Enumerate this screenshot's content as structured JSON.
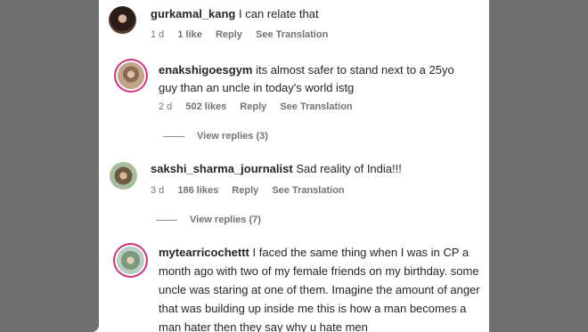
{
  "comments": [
    {
      "username": "gurkamal_kang",
      "text": "I can relate that",
      "time": "1 d",
      "likes": "1 like",
      "reply": "Reply",
      "translate": "See Translation"
    },
    {
      "username": "enakshigoesgym",
      "text": "its almost safer to stand next to a 25yo guy than an uncle in today's world istg",
      "time": "2 d",
      "likes": "502 likes",
      "reply": "Reply",
      "translate": "See Translation",
      "view_replies": "View replies (3)"
    },
    {
      "username": "sakshi_sharma_journalist",
      "text": "Sad reality of India!!!",
      "time": "3 d",
      "likes": "186 likes",
      "reply": "Reply",
      "translate": "See Translation",
      "view_replies": "View replies (7)"
    },
    {
      "username": "mytearricochettt",
      "text": "I faced the same thing when I was in CP a month ago with two of my female friends on my birthday. some uncle was staring at one of them. Imagine the amount of anger that was building up inside me this is how a man becomes a man hater then they say why u hate men"
    }
  ],
  "colors": {
    "story_ring": "#d3307a",
    "side_bars": "#707070",
    "secondary_text": "#737373"
  }
}
